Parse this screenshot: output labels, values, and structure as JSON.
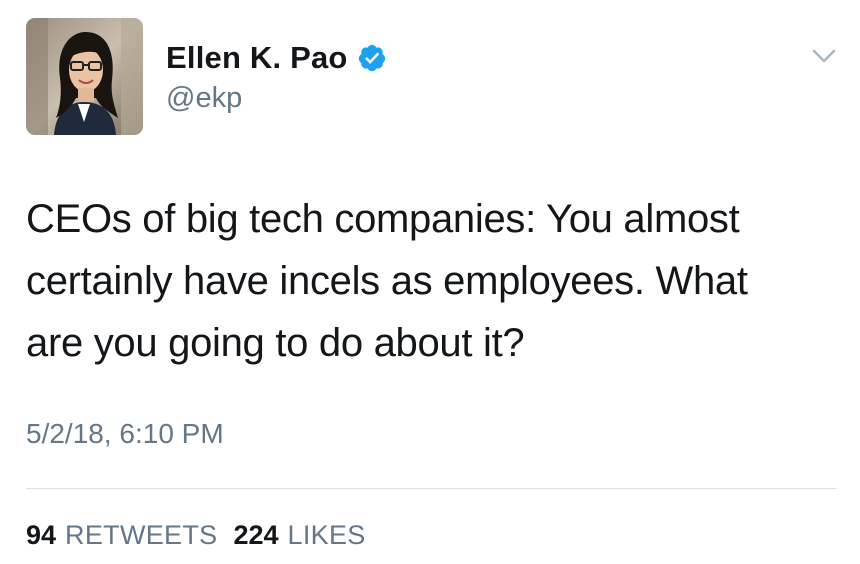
{
  "tweet": {
    "author": {
      "display_name": "Ellen K. Pao",
      "handle": "@ekp",
      "verified": true,
      "avatar_icon": "profile-photo"
    },
    "menu_icon": "chevron-down-icon",
    "text_lines": [
      "CEOs of big tech companies: You almost",
      "certainly have incels as employees. What",
      "are you going to do about it?"
    ],
    "timestamp": "5/2/18, 6:10 PM",
    "stats": {
      "retweets_count": "94",
      "retweets_label": "RETWEETS",
      "likes_count": "224",
      "likes_label": "LIKES"
    }
  },
  "colors": {
    "text": "#14171a",
    "secondary": "#657786",
    "verified": "#1da1f2",
    "divider": "#d9e0e5"
  }
}
